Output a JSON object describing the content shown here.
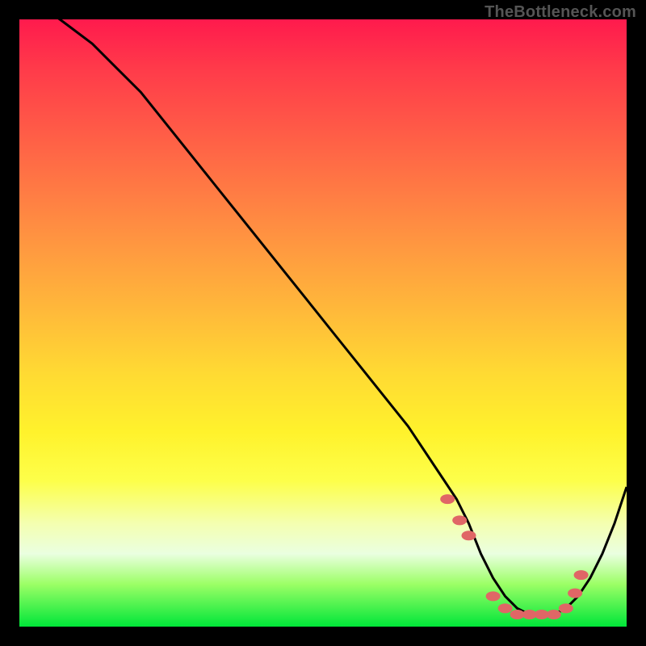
{
  "watermark": "TheBottleneck.com",
  "chart_data": {
    "type": "line",
    "title": "",
    "xlabel": "",
    "ylabel": "",
    "xlim": [
      0,
      100
    ],
    "ylim": [
      0,
      100
    ],
    "grid": false,
    "legend": false,
    "series": [
      {
        "name": "bottleneck-curve",
        "x": [
          0,
          4,
          8,
          12,
          16,
          20,
          24,
          28,
          32,
          36,
          40,
          44,
          48,
          52,
          56,
          60,
          64,
          68,
          70,
          72,
          74,
          76,
          78,
          80,
          82,
          84,
          86,
          88,
          90,
          92,
          94,
          96,
          98,
          100
        ],
        "y": [
          105,
          102,
          99,
          96,
          92,
          88,
          83,
          78,
          73,
          68,
          63,
          58,
          53,
          48,
          43,
          38,
          33,
          27,
          24,
          21,
          17,
          12,
          8,
          5,
          3,
          2,
          2,
          2,
          3,
          5,
          8,
          12,
          17,
          23
        ]
      }
    ],
    "markers": {
      "name": "highlight-dots",
      "color": "#e06666",
      "x": [
        70.5,
        72.5,
        74.0,
        78.0,
        80.0,
        82.0,
        84.0,
        86.0,
        88.0,
        90.0,
        91.5,
        92.5
      ],
      "y": [
        21.0,
        17.5,
        15.0,
        5.0,
        3.0,
        2.0,
        2.0,
        2.0,
        2.0,
        3.0,
        5.5,
        8.5
      ]
    }
  },
  "colors": {
    "background": "#000000",
    "curve": "#000000",
    "marker": "#e06666",
    "gradient_top": "#ff1a4d",
    "gradient_bottom": "#00e639"
  }
}
